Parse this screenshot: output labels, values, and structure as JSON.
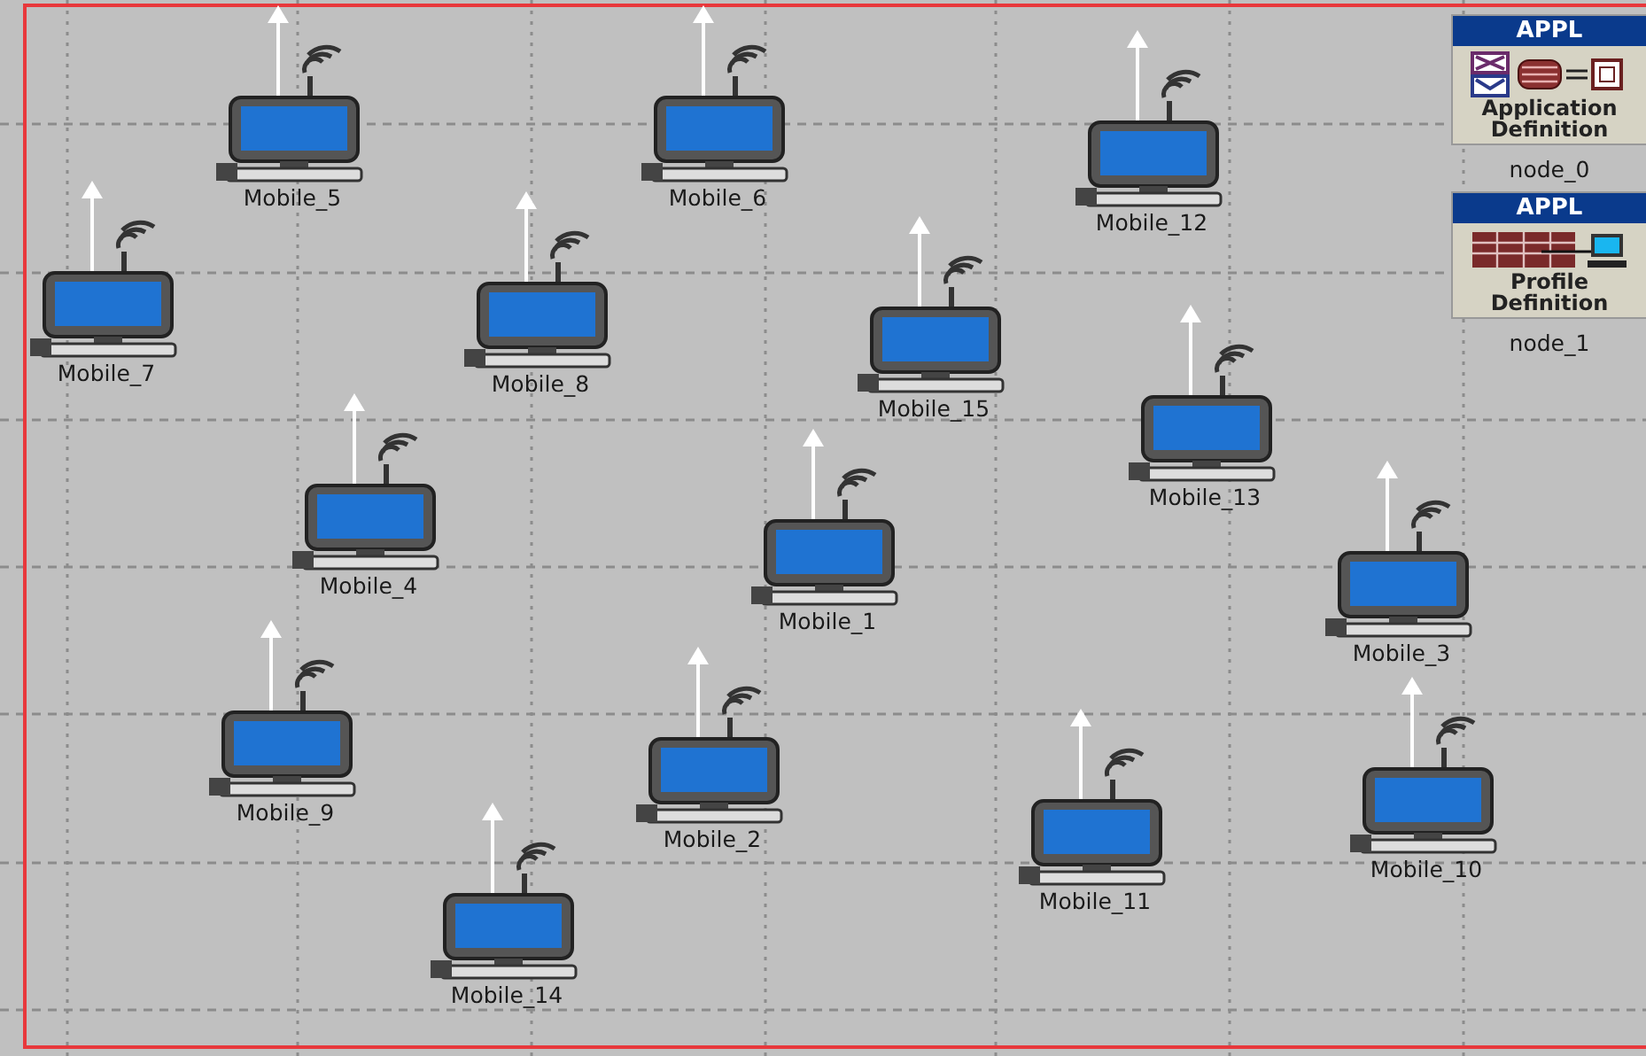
{
  "canvas": {
    "nodes": [
      {
        "label": "Mobile_5"
      },
      {
        "label": "Mobile_6"
      },
      {
        "label": "Mobile_12"
      },
      {
        "label": "Mobile_7"
      },
      {
        "label": "Mobile_8"
      },
      {
        "label": "Mobile_15"
      },
      {
        "label": "Mobile_13"
      },
      {
        "label": "Mobile_4"
      },
      {
        "label": "Mobile_1"
      },
      {
        "label": "Mobile_3"
      },
      {
        "label": "Mobile_9"
      },
      {
        "label": "Mobile_2"
      },
      {
        "label": "Mobile_11"
      },
      {
        "label": "Mobile_10"
      },
      {
        "label": "Mobile_14"
      }
    ],
    "config_nodes": [
      {
        "kind": "application",
        "badge": "APPL",
        "title": "Application Definition",
        "label": "node_0"
      },
      {
        "kind": "profile",
        "badge": "APPL",
        "title": "Profile Definition",
        "label": "node_1"
      }
    ]
  }
}
